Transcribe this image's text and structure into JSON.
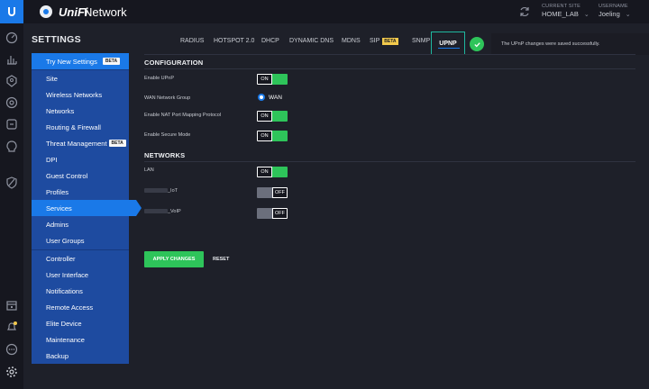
{
  "header": {
    "brand_name": "UniFi",
    "brand_sub": "Network",
    "current_site_label": "CURRENT SITE",
    "current_site_value": "HOME_LAB",
    "username_label": "USERNAME",
    "username_value": "Joeling",
    "chevron": "⌄"
  },
  "rail": {
    "icons": [
      "dashboard-icon",
      "statistics-icon",
      "map-icon",
      "devices-icon",
      "clients-icon",
      "insights-icon",
      "shield-icon",
      "calendar-icon",
      "alerts-icon",
      "chat-icon",
      "settings-icon"
    ],
    "alert_badge_color": "#f2c94c"
  },
  "settings": {
    "title": "SETTINGS",
    "items": [
      {
        "label": "Try New Settings",
        "beta": "BETA"
      },
      {
        "label": "Site"
      },
      {
        "label": "Wireless Networks"
      },
      {
        "label": "Networks"
      },
      {
        "label": "Routing & Firewall"
      },
      {
        "label": "Threat Management",
        "beta": "BETA"
      },
      {
        "label": "DPI"
      },
      {
        "label": "Guest Control"
      },
      {
        "label": "Profiles"
      },
      {
        "label": "Services",
        "active": true
      },
      {
        "label": "Admins"
      },
      {
        "label": "User Groups"
      },
      {
        "label": "Controller"
      },
      {
        "label": "User Interface"
      },
      {
        "label": "Notifications"
      },
      {
        "label": "Remote Access"
      },
      {
        "label": "Elite Device"
      },
      {
        "label": "Maintenance"
      },
      {
        "label": "Backup"
      }
    ]
  },
  "tabs": {
    "items": [
      "RADIUS",
      "HOTSPOT 2.0",
      "DHCP",
      "DYNAMIC DNS",
      "MDNS",
      "SIP",
      "SNMP"
    ],
    "sip_beta": "BETA",
    "active": "UPNP"
  },
  "toast": {
    "message": "The UPnP changes were saved successfully."
  },
  "configuration": {
    "title": "CONFIGURATION",
    "rows": [
      {
        "label": "Enable UPnP",
        "state": "ON"
      },
      {
        "label": "WAN Network Group",
        "radio": "WAN"
      },
      {
        "label": "Enable NAT Port Mapping Protocol",
        "state": "ON"
      },
      {
        "label": "Enable Secure Mode",
        "state": "ON"
      }
    ]
  },
  "networks": {
    "title": "NETWORKS",
    "rows": [
      {
        "label": "LAN",
        "state": "ON"
      },
      {
        "label": "_IoT",
        "state": "OFF"
      },
      {
        "label": "_VoIP",
        "state": "OFF"
      }
    ]
  },
  "actions": {
    "apply": "APPLY CHANGES",
    "reset": "RESET"
  },
  "colors": {
    "accent": "#1a79e8",
    "success": "#2ec45a",
    "sidebar": "#1e4ba0",
    "highlight_border": "#1fb8a0"
  }
}
